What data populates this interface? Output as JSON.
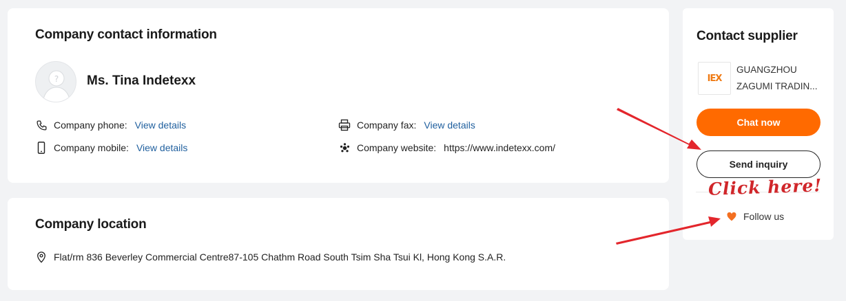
{
  "contact": {
    "title": "Company contact information",
    "person_name": "Ms. Tina Indetexx",
    "phone_label": "Company phone:",
    "phone_value": "View details",
    "mobile_label": "Company mobile:",
    "mobile_value": "View details",
    "fax_label": "Company fax:",
    "fax_value": "View details",
    "website_label": "Company website:",
    "website_value": "https://www.indetexx.com/"
  },
  "location": {
    "title": "Company location",
    "address": "Flat/rm 836 Beverley Commercial Centre87-105 Chathm Road South Tsim Sha Tsui Kl, Hong Kong S.A.R."
  },
  "supplier": {
    "title": "Contact supplier",
    "logo_text": "IEX",
    "company_line1": "GUANGZHOU",
    "company_line2": "ZAGUMI TRADIN...",
    "chat_label": "Chat now",
    "inquiry_label": "Send inquiry",
    "follow_label": "Follow us"
  },
  "annotation": {
    "text": "Click here!"
  },
  "colors": {
    "accent": "#ff6a00",
    "link": "#1f5f9e",
    "annotation": "#e3262c"
  },
  "icons": [
    "avatar-placeholder-icon",
    "phone-icon",
    "mobile-icon",
    "fax-icon",
    "website-icon",
    "location-pin-icon",
    "heart-icon",
    "logo"
  ]
}
